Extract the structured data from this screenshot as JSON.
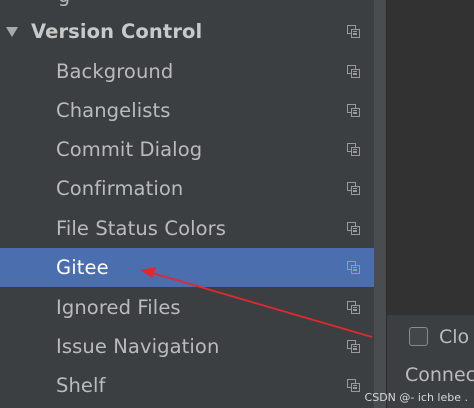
{
  "tree": {
    "top_partial_glyph": "g",
    "group": {
      "label": "Version Control",
      "expanded": true,
      "icon": "chevron-down-icon"
    },
    "items": [
      {
        "label": "Background",
        "selected": false,
        "icon": "copy-icon"
      },
      {
        "label": "Changelists",
        "selected": false,
        "icon": "copy-icon"
      },
      {
        "label": "Commit Dialog",
        "selected": false,
        "icon": "copy-icon"
      },
      {
        "label": "Confirmation",
        "selected": false,
        "icon": "copy-icon"
      },
      {
        "label": "File Status Colors",
        "selected": false,
        "icon": "copy-icon"
      },
      {
        "label": "Gitee",
        "selected": true,
        "icon": "copy-icon"
      },
      {
        "label": "Ignored Files",
        "selected": false,
        "icon": "copy-icon"
      },
      {
        "label": "Issue Navigation",
        "selected": false,
        "icon": "copy-icon"
      },
      {
        "label": "Shelf",
        "selected": false,
        "icon": "copy-icon"
      }
    ]
  },
  "right_panel": {
    "checkbox_label": "Clo",
    "checkbox_checked": false,
    "connect_label": "Connec"
  },
  "watermark": "CSDN @- ich lebe .",
  "colors": {
    "background": "#3c3f41",
    "selection": "#4b6eaf",
    "text": "#bbbbbb",
    "annotation_arrow": "#e0282e"
  }
}
